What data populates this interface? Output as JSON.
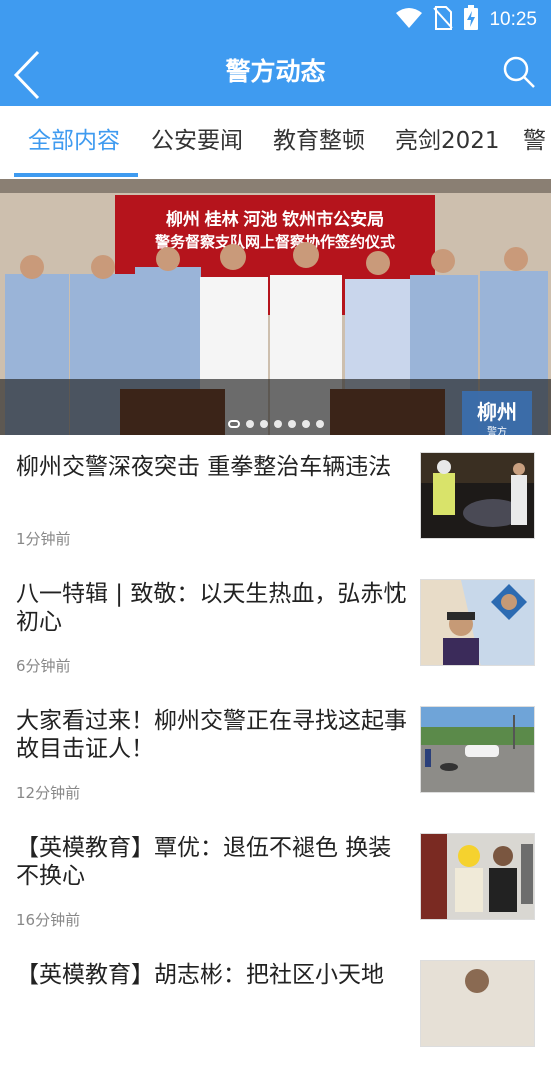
{
  "status": {
    "time": "10:25",
    "icons": [
      "wifi-icon",
      "no-sim-icon",
      "battery-charging-icon"
    ]
  },
  "appbar": {
    "title": "警方动态",
    "back_icon": "back-arrow-icon",
    "search_icon": "search-icon"
  },
  "tabs": [
    {
      "label": "全部内容",
      "active": true
    },
    {
      "label": "公安要闻",
      "active": false
    },
    {
      "label": "教育整顿",
      "active": false
    },
    {
      "label": "亮剑2021",
      "active": false
    },
    {
      "label": "警",
      "active": false
    }
  ],
  "banner": {
    "line1": "柳州 桂林 河池 钦州市公安局",
    "line2": "警务督察支队网上督察协作签约仪式",
    "watermark": "柳州",
    "watermark2": "警方",
    "dots_count": 7,
    "active_dot": 0
  },
  "news": [
    {
      "title": "柳州交警深夜突击 重拳整治车辆违法",
      "time": "1分钟前",
      "thumb": "motorcycle-inspection"
    },
    {
      "title": "八一特辑 | 致敬：以天生热血，弘赤忱初心",
      "time": "6分钟前",
      "thumb": "soldier-portrait"
    },
    {
      "title": "大家看过来！柳州交警正在寻找这起事故目击证人！",
      "time": "12分钟前",
      "thumb": "accident-scene"
    },
    {
      "title": "【英模教育】覃优：退伍不褪色 换装不换心",
      "time": "16分钟前",
      "thumb": "two-men-photo"
    },
    {
      "title": "【英模教育】胡志彬：把社区小天地",
      "time": "",
      "thumb": "person-photo"
    }
  ],
  "colors": {
    "accent": "#3f9bf0",
    "text": "#222222",
    "muted": "#888888"
  }
}
